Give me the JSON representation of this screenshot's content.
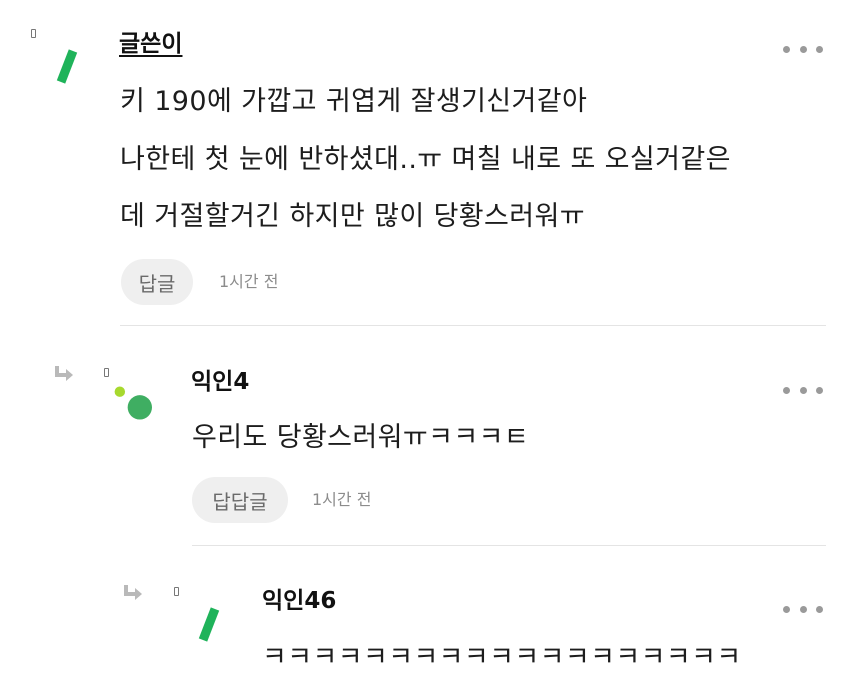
{
  "comments": [
    {
      "author": "글쓴이",
      "lines": [
        "키 190에 가깝고 귀엽게 잘생기신거같아",
        "나한테 첫 눈에 반하셨대..ㅠ 며칠 내로 또 오실거같은",
        "데 거절할거긴 하지만 많이 당황스러워ㅠ"
      ],
      "reply_label": "답글",
      "time": "1시간 전",
      "avatar_icon": "green-slash-avatar-icon"
    },
    {
      "author": "익인4",
      "lines": [
        "우리도 당황스러워ㅠㅋㅋㅋㅌ"
      ],
      "reply_label": "답답글",
      "time": "1시간 전",
      "avatar_icon": "green-circle-avatar-icon"
    },
    {
      "author": "익인46",
      "lines": [
        "ㅋㅋㅋㅋㅋㅋㅋㅋㅋㅋㅋㅋㅋㅋㅋㅋㅋㅋㅋ"
      ],
      "avatar_icon": "green-slash-avatar-icon"
    }
  ],
  "colors": {
    "accent_green": "#1fb35a",
    "circle_green": "#3fae62",
    "dot_lime": "#a7d92e",
    "reply_bg": "#efefef",
    "more_dots": "#9a9a9a"
  }
}
